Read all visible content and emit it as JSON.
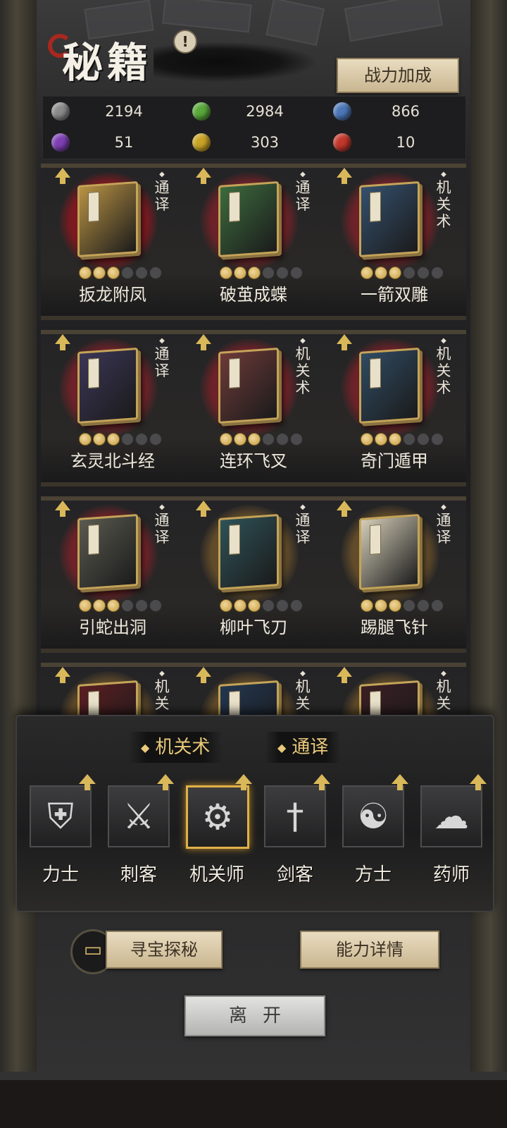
{
  "header": {
    "title": "秘籍",
    "alert_icon": "!",
    "power_button": "战力加成"
  },
  "resources": [
    {
      "color": "#8a8a8a",
      "value": "2194"
    },
    {
      "color": "#58a83a",
      "value": "2984"
    },
    {
      "color": "#4b77b8",
      "value": "866"
    },
    {
      "color": "#7d3fb2",
      "value": "51"
    },
    {
      "color": "#c9a325",
      "value": "303"
    },
    {
      "color": "#c1372a",
      "value": "10"
    }
  ],
  "books": [
    {
      "name": "扳龙附凤",
      "tag": "通译",
      "stars": 3,
      "seal": "active",
      "cover": "#b89244"
    },
    {
      "name": "破茧成蝶",
      "tag": "通译",
      "stars": 3,
      "seal": "red",
      "cover": "#3c6b3e"
    },
    {
      "name": "一箭双雕",
      "tag": "机关术",
      "stars": 3,
      "seal": "red",
      "cover": "#34506e"
    },
    {
      "name": "玄灵北斗经",
      "tag": "通译",
      "stars": 3,
      "seal": "red",
      "cover": "#3a3656"
    },
    {
      "name": "连环飞叉",
      "tag": "机关术",
      "stars": 3,
      "seal": "red",
      "cover": "#6d3a38"
    },
    {
      "name": "奇门遁甲",
      "tag": "机关术",
      "stars": 3,
      "seal": "red",
      "cover": "#2f4b63"
    },
    {
      "name": "引蛇出洞",
      "tag": "通译",
      "stars": 3,
      "seal": "red",
      "cover": "#5a5a50"
    },
    {
      "name": "柳叶飞刀",
      "tag": "通译",
      "stars": 3,
      "seal": "gold",
      "cover": "#2e5258"
    },
    {
      "name": "踢腿飞针",
      "tag": "通译",
      "stars": 3,
      "seal": "gold",
      "cover": "#d4cdb8"
    },
    {
      "name": "",
      "tag": "机关",
      "stars": 0,
      "seal": "gold",
      "cover": "#5a1e22"
    },
    {
      "name": "",
      "tag": "机关",
      "stars": 0,
      "seal": "gold",
      "cover": "#233650"
    },
    {
      "name": "",
      "tag": "机关",
      "stars": 0,
      "seal": "gold",
      "cover": "#3a1e24"
    }
  ],
  "filters": {
    "tag1": "机关术",
    "tag2": "通译",
    "diamond": "◆"
  },
  "classes": [
    {
      "name": "力士",
      "icon": "shield-icon",
      "glyph": "⛨",
      "selected": false
    },
    {
      "name": "刺客",
      "icon": "claw-icon",
      "glyph": "⚔",
      "selected": false
    },
    {
      "name": "机关师",
      "icon": "gears-icon",
      "glyph": "⚙",
      "selected": true
    },
    {
      "name": "剑客",
      "icon": "sword-icon",
      "glyph": "†",
      "selected": false
    },
    {
      "name": "方士",
      "icon": "yin-yang-icon",
      "glyph": "☯",
      "selected": false
    },
    {
      "name": "药师",
      "icon": "cloud-icon",
      "glyph": "☁",
      "selected": false
    }
  ],
  "actions": {
    "treasure": "寻宝探秘",
    "details": "能力详情",
    "leave": "离开"
  }
}
